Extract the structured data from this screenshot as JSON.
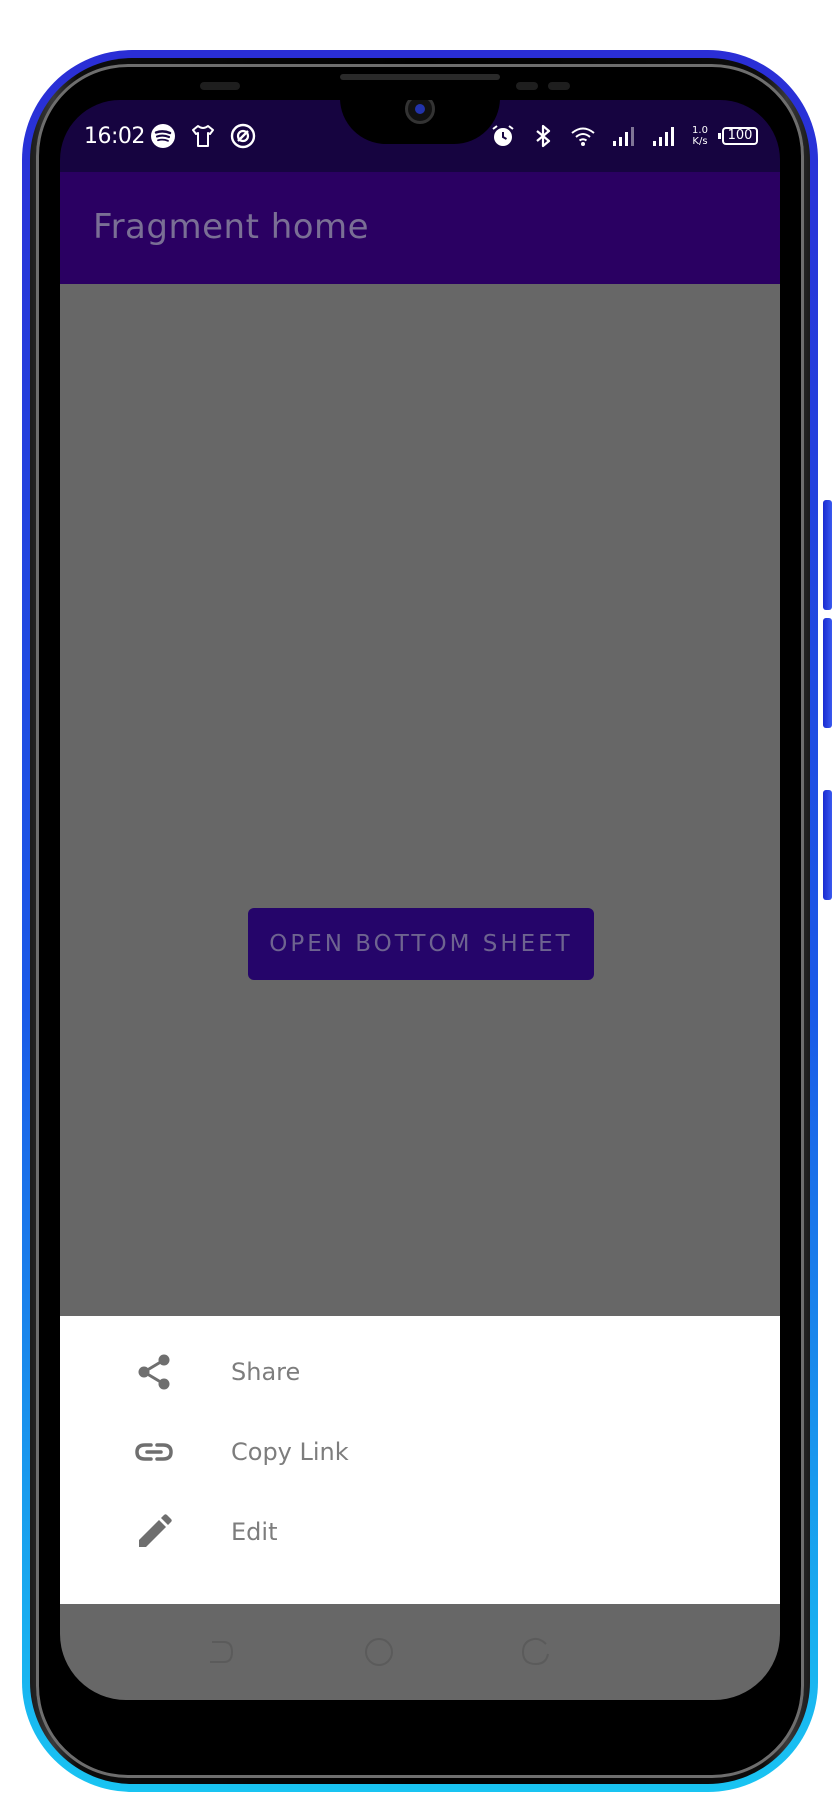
{
  "status_bar": {
    "time": "16:02",
    "left_icons": [
      "spotify-icon",
      "tshirt-icon",
      "at-sign-icon"
    ],
    "right_icons": [
      "alarm-icon",
      "bluetooth-icon",
      "wifi-icon",
      "signal-icon",
      "signal-icon"
    ],
    "net_speed_value": "1.0",
    "net_speed_unit": "K/s",
    "battery": "100"
  },
  "app_bar": {
    "title": "Fragment home",
    "background": "#2a0062"
  },
  "main": {
    "background": "#676767",
    "open_button_label": "OPEN BOTTOM SHEET"
  },
  "bottom_sheet": {
    "items": [
      {
        "label": "Share",
        "icon": "share-icon"
      },
      {
        "label": "Copy Link",
        "icon": "link-icon"
      },
      {
        "label": "Edit",
        "icon": "pencil-icon"
      }
    ]
  },
  "nav_bar": {
    "buttons": [
      "back-icon",
      "home-icon",
      "recents-icon"
    ]
  },
  "colors": {
    "primary": "#2a0062",
    "status_bar": "#160440",
    "scrim": "#676767",
    "sheet_text": "#7d7d7d",
    "frame_top": "#2a2ed6",
    "frame_bottom": "#19c4f2"
  }
}
